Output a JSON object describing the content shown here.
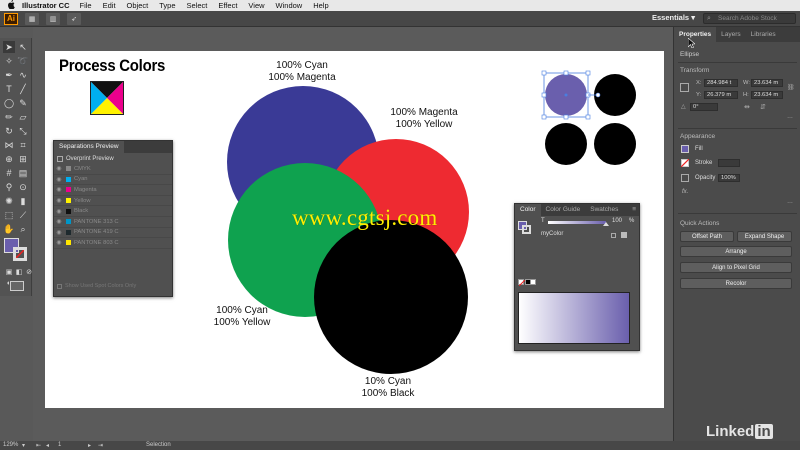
{
  "menubar": {
    "apple": "",
    "app_name": "Illustrator CC",
    "items": [
      "File",
      "Edit",
      "Object",
      "Type",
      "Select",
      "Effect",
      "View",
      "Window",
      "Help"
    ]
  },
  "appbar": {
    "logo": "Ai",
    "workspace": "Essentials",
    "search_placeholder": "Search Adobe Stock"
  },
  "artboard": {
    "title": "Process Colors",
    "labels": {
      "cyan_magenta": [
        "100% Cyan",
        "100% Magenta"
      ],
      "magenta_yellow": [
        "100% Magenta",
        "100% Yellow"
      ],
      "cyan_yellow": [
        "100% Cyan",
        "100% Yellow"
      ],
      "cyan_black": [
        "10% Cyan",
        "100% Black"
      ]
    },
    "colors": {
      "blue": "#3a3a96",
      "red": "#ee2a31",
      "green": "#0fa24f",
      "black": "#000000",
      "selected": "#6a5fad"
    }
  },
  "separations_panel": {
    "title": "Separations Preview",
    "overprint": "Overprint Preview",
    "rows": [
      {
        "label": "CMYK",
        "color": "#888888"
      },
      {
        "label": "Cyan",
        "color": "#00aeef"
      },
      {
        "label": "Magenta",
        "color": "#ec008c"
      },
      {
        "label": "Yellow",
        "color": "#fff200"
      },
      {
        "label": "Black",
        "color": "#111111"
      },
      {
        "label": "PANTONE 313 C",
        "color": "#0096c8"
      },
      {
        "label": "PANTONE 419 C",
        "color": "#1e2a2e"
      },
      {
        "label": "PANTONE 803 C",
        "color": "#ffe600"
      }
    ],
    "footer": "Show Used Spot Colors Only"
  },
  "color_panel": {
    "tabs": [
      "Color",
      "Color Guide",
      "Swatches"
    ],
    "tint_label": "T",
    "tint_value": "100",
    "tint_unit": "%",
    "swatch_name": "myColor"
  },
  "properties": {
    "tabs": [
      "Properties",
      "Layers",
      "Libraries"
    ],
    "object_type": "Ellipse",
    "transform_label": "Transform",
    "x_label": "X:",
    "x_value": "284.984 t",
    "y_label": "Y:",
    "y_value": "26.379 m",
    "w_label": "W:",
    "w_value": "23.634 m",
    "h_label": "H:",
    "h_value": "23.634 m",
    "angle_value": "0°",
    "appearance_label": "Appearance",
    "fill_label": "Fill",
    "stroke_label": "Stroke",
    "opacity_label": "Opacity",
    "opacity_value": "100%",
    "fx_label": "fx.",
    "quick_actions_label": "Quick Actions",
    "buttons": {
      "offset_path": "Offset Path",
      "expand_shape": "Expand Shape",
      "arrange": "Arrange",
      "align_pixel": "Align to Pixel Grid",
      "recolor": "Recolor"
    }
  },
  "statusbar": {
    "zoom": "129%",
    "artboard_num": "1",
    "tool": "Selection"
  },
  "watermarks": {
    "linkedin_text": "Linked",
    "linkedin_in": "in",
    "site": "www.cgtsj.com"
  }
}
